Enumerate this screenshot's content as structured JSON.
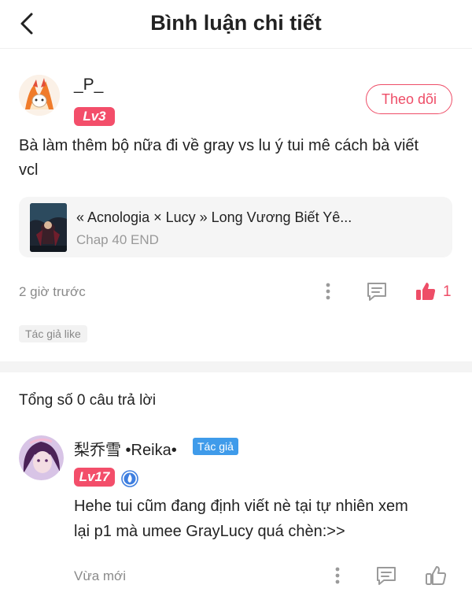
{
  "header": {
    "title": "Bình luận chi tiết"
  },
  "comment": {
    "username": "_P_",
    "level": "Lv3",
    "follow_label": "Theo dõi",
    "text_line1": "Bà làm thêm bộ nữa đi về gray vs lu ý tui mê cách bà viết",
    "text_line2": "vcl",
    "story": {
      "title": "« Acnologia × Lucy » Long Vương Biết Yê...",
      "chapter": "Chap 40 END"
    },
    "time": "2 giờ trước",
    "like_count": "1",
    "author_like_tag": "Tác giả like"
  },
  "replies": {
    "count_label": "Tổng số 0 câu trả lời",
    "items": [
      {
        "username": "梨乔雪 •Reika•",
        "author_tag": "Tác giả",
        "level": "Lv17",
        "text_line1": "Hehe tui cũm đang định viết nè tại tự nhiên xem",
        "text_line2": "lại p1 mà umee GrayLucy quá chèn:>>",
        "time": "Vừa mới"
      }
    ]
  },
  "colors": {
    "accent": "#ee4d67",
    "author_tag": "#3f9bea",
    "muted": "#8a8a8a"
  },
  "icons": [
    "chevron-left-icon",
    "more-vertical-icon",
    "comment-icon",
    "thumbs-up-filled-icon",
    "thumbs-up-outline-icon",
    "verified-flame-icon"
  ]
}
